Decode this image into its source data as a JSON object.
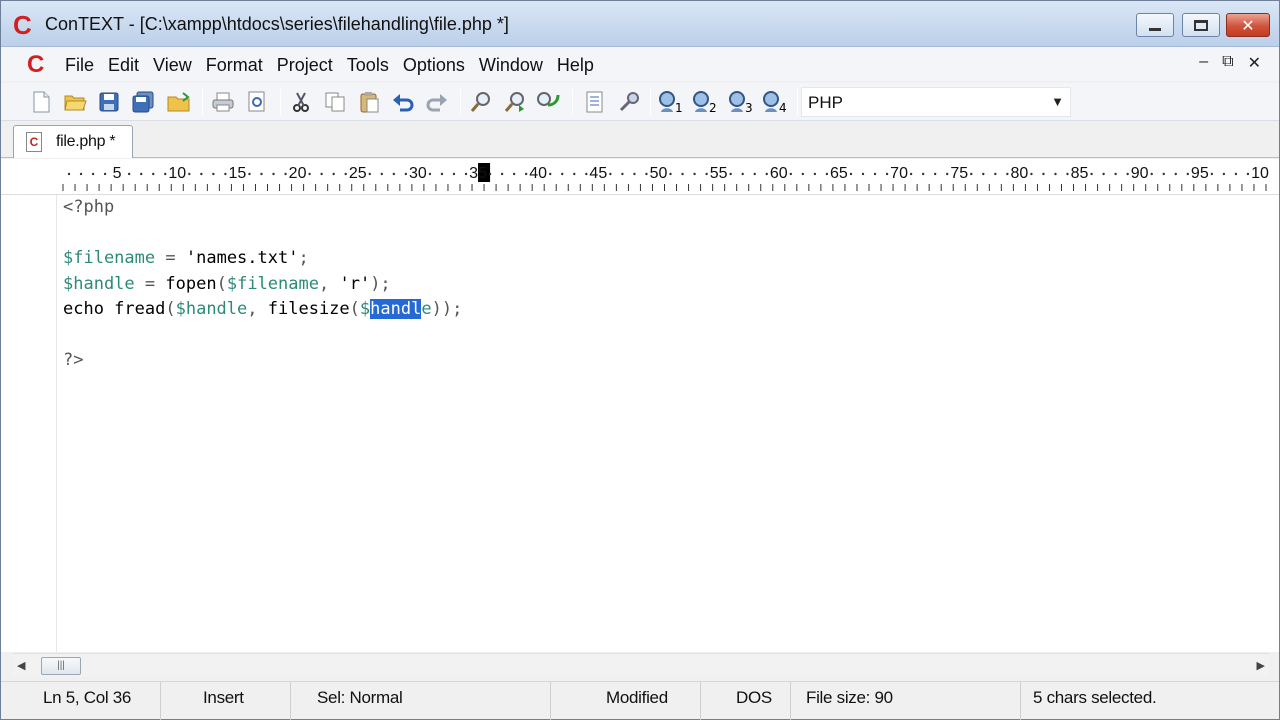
{
  "window": {
    "title": "ConTEXT - [C:\\xampp\\htdocs\\series\\filehandling\\file.php *]",
    "logo": "C"
  },
  "menu": {
    "items": [
      "File",
      "Edit",
      "View",
      "Format",
      "Project",
      "Tools",
      "Options",
      "Window",
      "Help"
    ],
    "mdi_controls": [
      "–",
      "⧉",
      "✕"
    ]
  },
  "toolbar": {
    "icons": [
      "new-file-icon",
      "open-file-icon",
      "save-icon",
      "save-all-icon",
      "open-folder-icon",
      "print-icon",
      "print-preview-icon",
      "cut-icon",
      "copy-icon",
      "paste-icon",
      "undo-icon",
      "redo-icon",
      "find-icon",
      "find-next-icon",
      "replace-icon",
      "file-compare-icon",
      "tools-icon",
      "user-command-1-icon",
      "user-command-2-icon",
      "user-command-3-icon",
      "user-command-4-icon"
    ],
    "highlighter": "PHP"
  },
  "tabs": [
    {
      "label": "file.php *"
    }
  ],
  "ruler": {
    "labels": [
      "5",
      "10",
      "15",
      "20",
      "25",
      "30",
      "35",
      "40",
      "45",
      "50",
      "55",
      "60",
      "65",
      "70",
      "75",
      "80",
      "85",
      "90",
      "95",
      "10"
    ],
    "cursor_column": 36
  },
  "editor": {
    "lines": [
      "<?php",
      "",
      "$filename = 'names.txt';",
      "$handle = fopen($filename, 'r');",
      "echo fread($handle, filesize($handle));",
      "",
      "?>"
    ],
    "selection": "handl"
  },
  "status": {
    "position": "Ln 5, Col 36",
    "mode": "Insert",
    "sel_mode": "Sel: Normal",
    "modified": "Modified",
    "line_endings": "DOS",
    "file_size": "File size: 90",
    "selection_info": "5 chars selected."
  }
}
